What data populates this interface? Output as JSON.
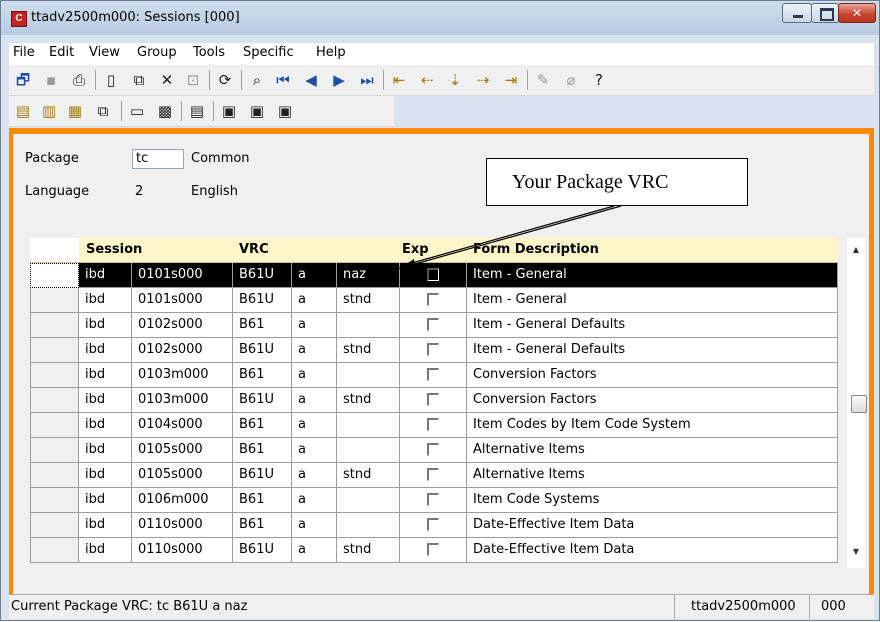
{
  "window": {
    "title": "ttadv2500m000: Sessions [000]"
  },
  "menu": [
    "File",
    "Edit",
    "View",
    "Group",
    "Tools",
    "Specific",
    "Help"
  ],
  "form": {
    "package_label": "Package",
    "package_value": "tc",
    "package_desc": "Common",
    "language_label": "Language",
    "language_value": "2",
    "language_desc": "English"
  },
  "callout": "Your Package VRC",
  "table": {
    "headers": {
      "session": "Session",
      "vrc": "VRC",
      "exp": "Exp",
      "form_description": "Form Description"
    },
    "rows": [
      {
        "pkg": "ibd",
        "code": "0101s000",
        "vrc": "B61U",
        "rel": "a",
        "cust": "naz",
        "desc": "Item - General",
        "selected": true
      },
      {
        "pkg": "ibd",
        "code": "0101s000",
        "vrc": "B61U",
        "rel": "a",
        "cust": "stnd",
        "desc": "Item - General"
      },
      {
        "pkg": "ibd",
        "code": "0102s000",
        "vrc": "B61",
        "rel": "a",
        "cust": "",
        "desc": "Item - General Defaults"
      },
      {
        "pkg": "ibd",
        "code": "0102s000",
        "vrc": "B61U",
        "rel": "a",
        "cust": "stnd",
        "desc": "Item - General Defaults"
      },
      {
        "pkg": "ibd",
        "code": "0103m000",
        "vrc": "B61",
        "rel": "a",
        "cust": "",
        "desc": "Conversion Factors"
      },
      {
        "pkg": "ibd",
        "code": "0103m000",
        "vrc": "B61U",
        "rel": "a",
        "cust": "stnd",
        "desc": "Conversion Factors"
      },
      {
        "pkg": "ibd",
        "code": "0104s000",
        "vrc": "B61",
        "rel": "a",
        "cust": "",
        "desc": "Item Codes by Item Code System"
      },
      {
        "pkg": "ibd",
        "code": "0105s000",
        "vrc": "B61",
        "rel": "a",
        "cust": "",
        "desc": "Alternative Items"
      },
      {
        "pkg": "ibd",
        "code": "0105s000",
        "vrc": "B61U",
        "rel": "a",
        "cust": "stnd",
        "desc": "Alternative Items"
      },
      {
        "pkg": "ibd",
        "code": "0106m000",
        "vrc": "B61",
        "rel": "a",
        "cust": "",
        "desc": "Item Code Systems"
      },
      {
        "pkg": "ibd",
        "code": "0110s000",
        "vrc": "B61",
        "rel": "a",
        "cust": "",
        "desc": "Date-Effective Item Data"
      },
      {
        "pkg": "ibd",
        "code": "0110s000",
        "vrc": "B61U",
        "rel": "a",
        "cust": "stnd",
        "desc": "Date-Effective Item Data"
      }
    ]
  },
  "status": {
    "message": "Current Package VRC: tc B61U a  naz",
    "session": "ttadv2500m000",
    "company": "000"
  },
  "colors": {
    "accent_border": "#ff8c00",
    "header_bg": "#fdf6c8",
    "selected_row": "#000000"
  }
}
